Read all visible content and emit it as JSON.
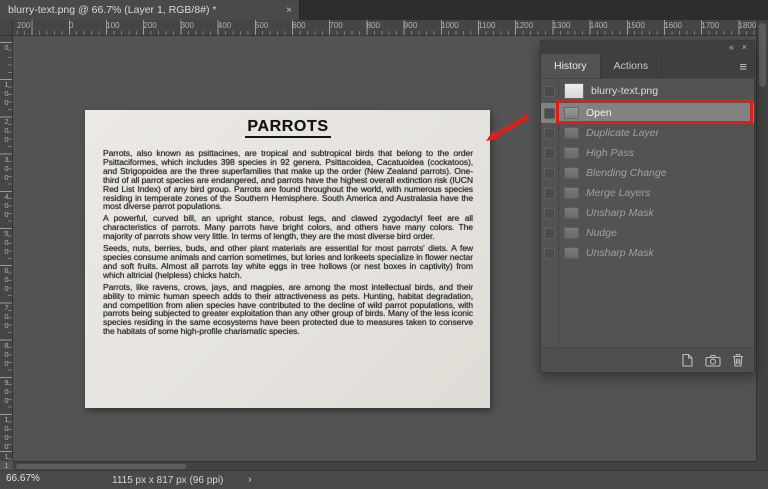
{
  "window": {
    "tab_title": "blurry-text.png @ 66.7% (Layer 1, RGB/8#) *",
    "tab_close": "×"
  },
  "rulers": {
    "horizontal": [
      "200",
      "0",
      "100",
      "200",
      "300",
      "400",
      "500",
      "600",
      "700",
      "800",
      "900",
      "1000",
      "1100",
      "1200",
      "1300",
      "1400",
      "1500",
      "1600",
      "1700",
      "1800"
    ],
    "vertical": [
      "0",
      "100",
      "200",
      "300",
      "400",
      "500",
      "600",
      "700",
      "800",
      "900",
      "1000",
      "1100"
    ]
  },
  "document": {
    "title": "PARROTS",
    "paragraphs": [
      "Parrots, also known as psittacines, are tropical and subtropical birds that belong to the order Psittaciformes, which includes 398 species in 92 genera. Psittacoidea, Cacatuoidea (cockatoos), and Strigopoidea are the three superfamilies that make up the order (New Zealand parrots). One-third of all parrot species are endangered, and parrots have the highest overall extinction risk (IUCN Red List Index) of any bird group. Parrots are found throughout the world, with numerous species residing in temperate zones of the Southern Hemisphere. South America and Australasia have the most diverse parrot populations.",
      "A powerful, curved bill, an upright stance, robust legs, and clawed zygodactyl feet are all characteristics of parrots. Many parrots have bright colors, and others have many colors. The majority of parrots show very little. In terms of length, they are the most diverse bird order.",
      "Seeds, nuts, berries, buds, and other plant materials are essential for most parrots' diets. A few species consume animals and carrion sometimes, but lories and lorikeets specialize in flower nectar and soft fruits. Almost all parrots lay white eggs in tree hollows (or nest boxes in captivity) from which altricial (helpless) chicks hatch.",
      "Parrots, like ravens, crows, jays, and magpies, are among the most intellectual birds, and their ability to mimic human speech adds to their attractiveness as pets. Hunting, habitat degradation, and competition from alien species have contributed to the decline of wild parrot populations, with parrots being subjected to greater exploitation than any other group of birds. Many of the less iconic species residing in the same ecosystems have been protected due to measures taken to conserve the habitats of some high-profile charismatic species."
    ]
  },
  "history_panel": {
    "tabs": [
      "History",
      "Actions"
    ],
    "active_tab": "History",
    "collapse_glyph": "«",
    "close_glyph": "×",
    "menu_glyph": "≡",
    "snapshot_label": "blurry-text.png",
    "states": [
      {
        "label": "Open",
        "selected": true,
        "undone": false
      },
      {
        "label": "Duplicate Layer",
        "selected": false,
        "undone": true
      },
      {
        "label": "High Pass",
        "selected": false,
        "undone": true
      },
      {
        "label": "Blending Change",
        "selected": false,
        "undone": true
      },
      {
        "label": "Merge Layers",
        "selected": false,
        "undone": true
      },
      {
        "label": "Unsharp Mask",
        "selected": false,
        "undone": true
      },
      {
        "label": "Nudge",
        "selected": false,
        "undone": true
      },
      {
        "label": "Unsharp Mask",
        "selected": false,
        "undone": true
      }
    ],
    "footer_icons": [
      "new-document-from-state-icon",
      "new-snapshot-icon",
      "delete-state-icon"
    ]
  },
  "status_bar": {
    "zoom": "66.67%",
    "doc_info": "1115 px x 817 px (96 ppi)",
    "arrow_glyph": "›"
  },
  "annotations": {
    "highlight_color": "#dd1f1a"
  }
}
